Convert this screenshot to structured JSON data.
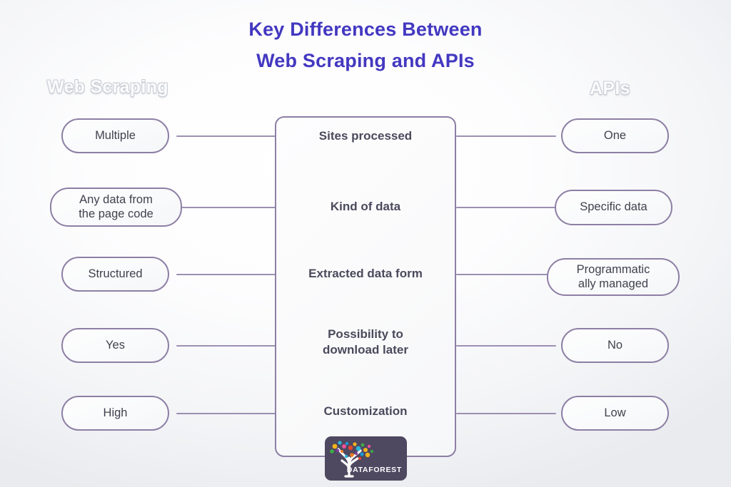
{
  "title": {
    "line1": "Key Differences Between",
    "line2": "Web Scraping and APIs",
    "color": "#4338c0"
  },
  "headers": {
    "left": "Web Scraping",
    "right": "APIs"
  },
  "colors": {
    "accent_border": "#8d7fa4",
    "connector": "#9d8fb2",
    "center_text": "#4a4a5c",
    "pill_text": "#41414f",
    "logo_bg": "#4f4861",
    "header_ghost": "#c9cdd6"
  },
  "comparison": {
    "rows": [
      {
        "criterion": "Sites processed",
        "web_scraping": "Multiple",
        "apis": "One"
      },
      {
        "criterion": "Kind of data",
        "web_scraping": "Any data from\nthe page code",
        "apis": "Specific data"
      },
      {
        "criterion": "Extracted data form",
        "web_scraping": "Structured",
        "apis": "Programmatic\nally managed"
      },
      {
        "criterion": "Possibility to\ndownload later",
        "web_scraping": "Yes",
        "apis": "No"
      },
      {
        "criterion": "Customization",
        "web_scraping": "High",
        "apis": "Low"
      }
    ]
  },
  "logo": {
    "name": "DATAFOREST",
    "dot_colors": [
      "#f5b41b",
      "#e8452c",
      "#29b6d8",
      "#7e3f98",
      "#3dae49",
      "#e9529a",
      "#f07d22",
      "#1b9ad6"
    ]
  }
}
